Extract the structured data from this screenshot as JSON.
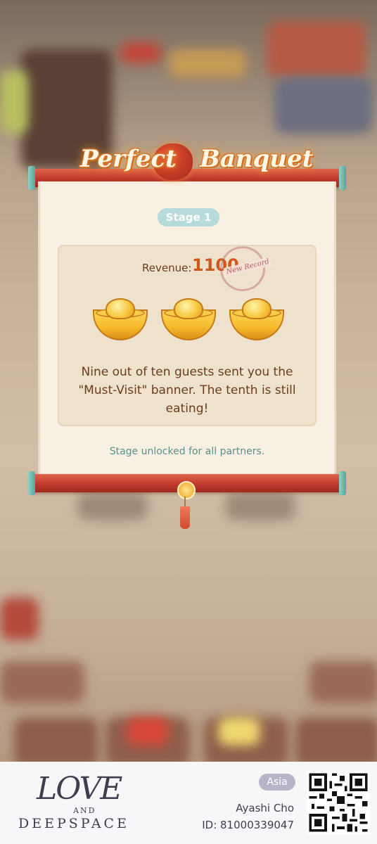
{
  "banner": {
    "title_word1": "Perfect",
    "title_word2": "Banquet"
  },
  "stage": {
    "label": "Stage 1"
  },
  "revenue": {
    "label": "Revenue:",
    "value": "1100",
    "stamp": "New Record"
  },
  "rating": {
    "ingots_earned": 3,
    "ingots_total": 3
  },
  "message": "Nine out of ten guests sent you the \"Must-Visit\" banner. The tenth is still eating!",
  "unlock_note": "Stage unlocked for all partners.",
  "footer": {
    "logo_line1": "LOVE",
    "logo_line2": "AND",
    "logo_line3": "DEEPSPACE",
    "region": "Asia",
    "player_name": "Ayashi Cho",
    "player_id": "ID: 81000339047"
  },
  "colors": {
    "accent": "#d2571c",
    "scroll_red": "#c0392b",
    "teal": "#b7dada",
    "paper": "#f8f1e3"
  }
}
